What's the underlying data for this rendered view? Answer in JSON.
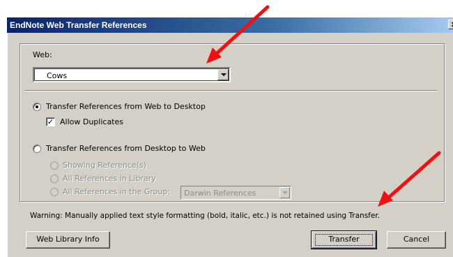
{
  "window": {
    "title": "EndNote Web Transfer References",
    "close_glyph": "x"
  },
  "web_section": {
    "label": "Web:",
    "selected": "Cows"
  },
  "options": {
    "transfer_web_to_desktop": "Transfer References from Web to Desktop",
    "allow_duplicates": "Allow Duplicates",
    "transfer_desktop_to_web": "Transfer References from Desktop to Web",
    "showing_references": "Showing Reference(s)",
    "all_references_library": "All References in Library",
    "all_references_group": "All References in the Group:",
    "group_selected": "Darwin References"
  },
  "warning": "Warning: Manually applied text style formatting (bold, italic, etc.) is not retained using Transfer.",
  "buttons": {
    "library_info": "Web Library Info",
    "transfer": "Transfer",
    "cancel": "Cancel"
  },
  "state": {
    "web_to_desktop_selected": true,
    "allow_duplicates_checked": true
  },
  "annotation_color": "#ee1111"
}
